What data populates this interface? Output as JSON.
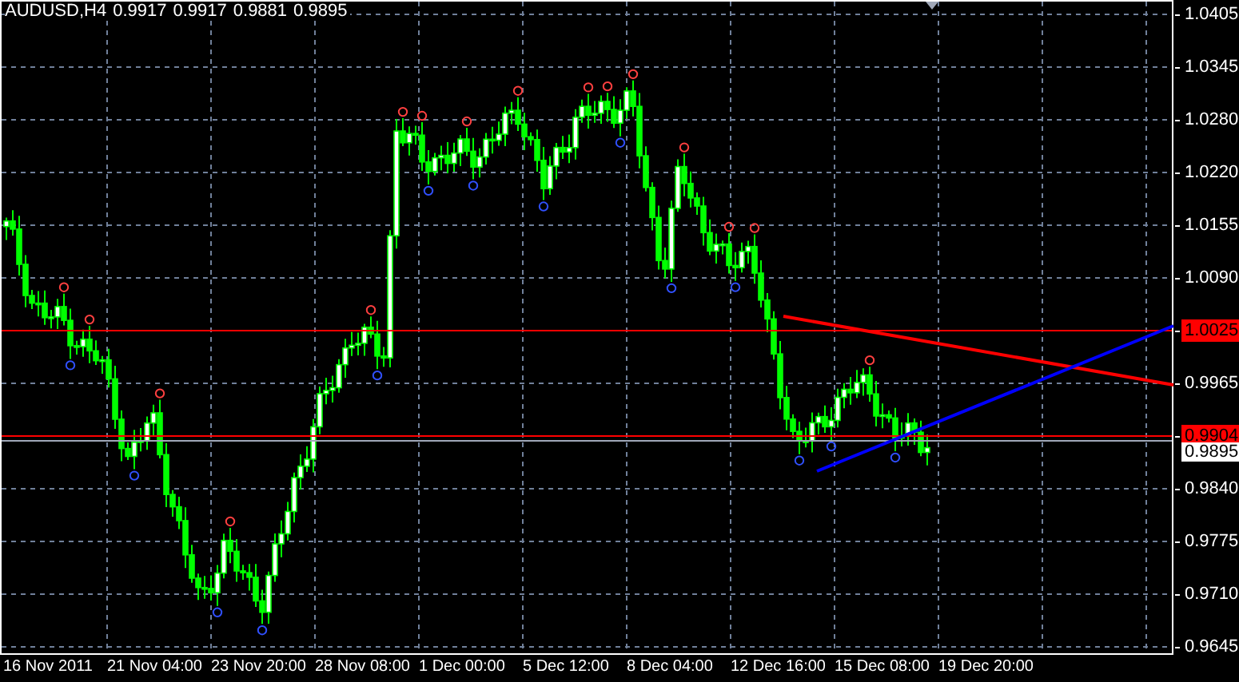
{
  "chart_header": {
    "symbol": "AUDUSD,H4",
    "quotes": [
      "0.9917",
      "0.9917",
      "0.9881",
      "0.9895"
    ]
  },
  "price_scale": [
    {
      "label": "1.0405",
      "kind": "grid"
    },
    {
      "label": "1.0345",
      "kind": "grid"
    },
    {
      "label": "1.0280",
      "kind": "grid"
    },
    {
      "label": "1.0220",
      "kind": "grid"
    },
    {
      "label": "1.0155",
      "kind": "grid"
    },
    {
      "label": "1.0090",
      "kind": "grid"
    },
    {
      "label": "1.0025",
      "kind": "level"
    },
    {
      "label": "0.9965",
      "kind": "grid"
    },
    {
      "label": "0.9904",
      "kind": "level"
    },
    {
      "label": "0.9840",
      "kind": "grid"
    },
    {
      "label": "0.9775",
      "kind": "grid"
    },
    {
      "label": "0.9710",
      "kind": "grid"
    },
    {
      "label": "0.9645",
      "kind": "grid"
    }
  ],
  "bid_label": "0.9895",
  "time_scale": [
    "16 Nov 2011",
    "21 Nov 04:00",
    "23 Nov 20:00",
    "28 Nov 08:00",
    "1 Dec 00:00",
    "5 Dec 12:00",
    "8 Dec 04:00",
    "12 Dec 16:00",
    "15 Dec 08:00",
    "19 Dec 20:00"
  ]
}
